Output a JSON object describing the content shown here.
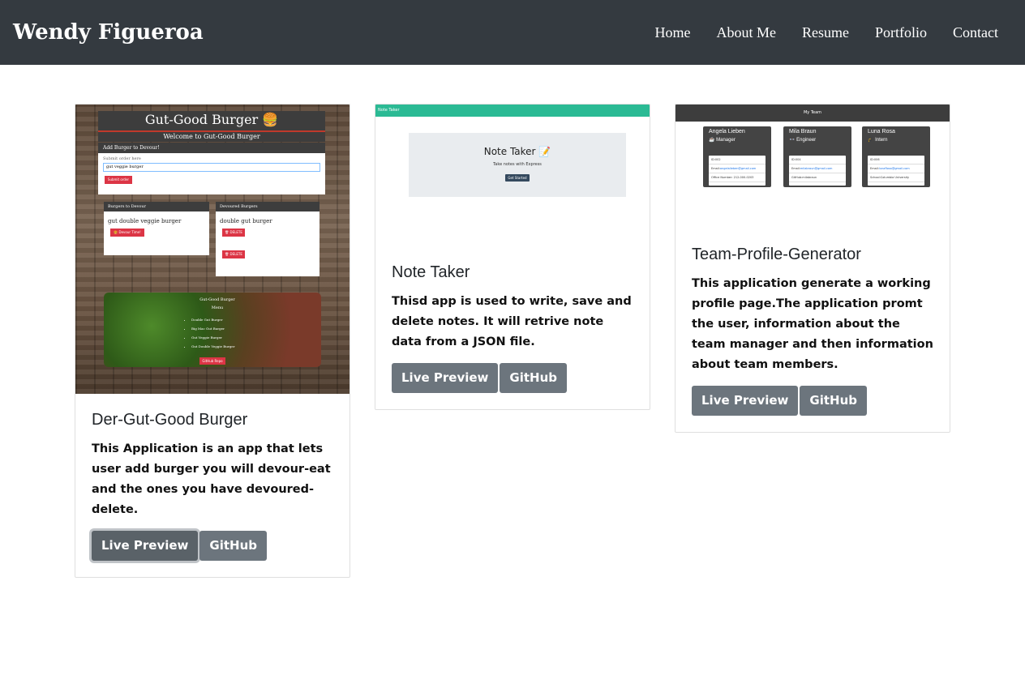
{
  "navbar": {
    "brand": "Wendy Figueroa",
    "links": [
      "Home",
      "About Me",
      "Resume",
      "Portfolio",
      "Contact"
    ]
  },
  "projects": [
    {
      "title": "Der-Gut-Good Burger",
      "description": "This Application is an app that lets user add burger you will devour-eat and the ones you have devoured-delete.",
      "live_label": "Live Preview",
      "github_label": "GitHub",
      "screenshot": {
        "heading": "Gut-Good Burger 🍔",
        "welcome": "Welcome to Gut-Good Burger",
        "form_title": "Add Burger to Devour!",
        "form_label": "Submit order here",
        "form_value": "gut veggie burger",
        "submit_label": "Submit order",
        "to_devour_title": "Burgers to Devour",
        "to_devour_item": "gut double veggie burger",
        "devour_btn": "🍔 Devour Time!",
        "devoured_title": "Devoured Burgers",
        "devoured_item": "double gut burger",
        "delete_btn": "🗑 DELETE",
        "menu_title": "Gut-Good Burger",
        "menu_sub": "Menu",
        "menu_items": [
          "Double Gut Burger",
          "Big Mac Gut Burger",
          "Gut Veggie Burger",
          "Gut Double Veggie Burger"
        ],
        "menu_btn": "GitHub Repo"
      }
    },
    {
      "title": "Note Taker",
      "description": "Thisd app is used to write, save and delete notes. It will retrive note data from a JSON file.",
      "live_label": "Live Preview",
      "github_label": "GitHub",
      "screenshot": {
        "bar": "Note Taker",
        "heading": "Note Taker 📝",
        "sub": "Take notes with Express",
        "btn": "Get Started"
      }
    },
    {
      "title": "Team-Profile-Generator",
      "description": "This application generate a working profile page.The application promt the user, information about the team manager and then information about team members.",
      "live_label": "Live Preview",
      "github_label": "GitHub",
      "screenshot": {
        "bar": "My Team",
        "members": [
          {
            "name": "Angela Lieben",
            "role": "☕ Manager",
            "id": "ID:002",
            "email_label": "Email:",
            "email": "angelalieben@gmail.com",
            "extra": "Office Number: 212-000-0203"
          },
          {
            "name": "Mila Braun",
            "role": "👓 Engineer",
            "id": "ID:004",
            "email_label": "Email:",
            "email": "milabraun@gmail.com",
            "extra": "GitHub:milabraun"
          },
          {
            "name": "Luna Rosa",
            "role": "🎓 Intern",
            "id": "ID:006",
            "email_label": "Email:",
            "email": "lunaRosa@gmail.com",
            "extra": "School:Columbia University"
          }
        ]
      }
    }
  ]
}
